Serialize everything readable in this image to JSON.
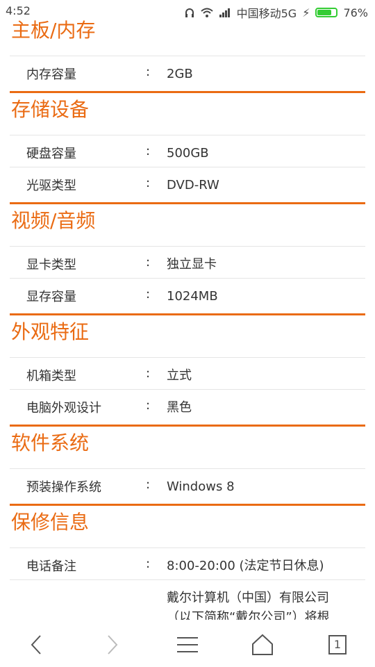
{
  "status_bar": {
    "time": "4:52",
    "carrier": "中国移动5G",
    "battery": "76%",
    "battery_level": 0.76
  },
  "sections": [
    {
      "title": "主板/内存",
      "rows": [
        {
          "label": "内存容量",
          "colon": ":",
          "value": "2GB"
        }
      ]
    },
    {
      "title": "存储设备",
      "rows": [
        {
          "label": "硬盘容量",
          "colon": ":",
          "value": "500GB"
        },
        {
          "label": "光驱类型",
          "colon": ":",
          "value": "DVD-RW"
        }
      ]
    },
    {
      "title": "视频/音频",
      "rows": [
        {
          "label": "显卡类型",
          "colon": ":",
          "value": "独立显卡"
        },
        {
          "label": "显存容量",
          "colon": ":",
          "value": "1024MB"
        }
      ]
    },
    {
      "title": "外观特征",
      "rows": [
        {
          "label": "机箱类型",
          "colon": ":",
          "value": "立式"
        },
        {
          "label": "电脑外观设计",
          "colon": ":",
          "value": "黑色"
        }
      ]
    },
    {
      "title": "软件系统",
      "rows": [
        {
          "label": "预装操作系统",
          "colon": ":",
          "value": "Windows 8"
        }
      ]
    },
    {
      "title": "保修信息",
      "rows": [
        {
          "label": "电话备注",
          "colon": ":",
          "value": "8:00-20:00 (法定节日休息)"
        }
      ]
    }
  ],
  "extra_text_line1": "戴尔计算机（中国）有限公司",
  "extra_text_line2": "（以下简称“戴尔公司”）将根",
  "nav": {
    "tabs_count": "1"
  },
  "colors": {
    "accent": "#ea6b13",
    "divider": "#e5e5e5"
  }
}
